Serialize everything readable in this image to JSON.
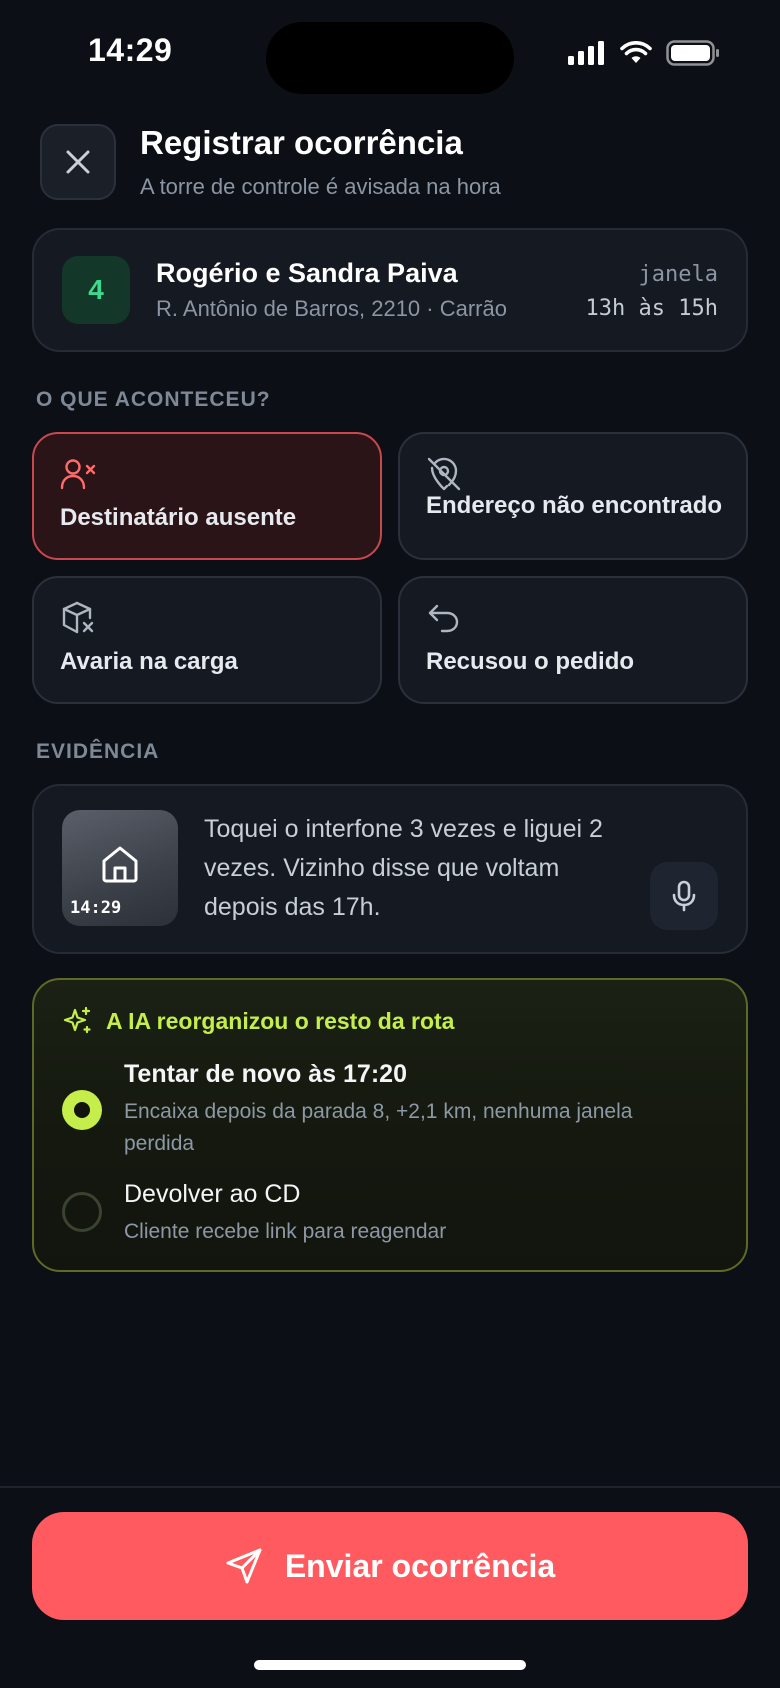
{
  "status_bar": {
    "time": "14:29"
  },
  "header": {
    "title": "Registrar ocorrência",
    "subtitle": "A torre de controle é avisada na hora"
  },
  "stop": {
    "number": "4",
    "name": "Rogério e Sandra Paiva",
    "address": "R. Antônio de Barros, 2210 · Carrão",
    "window_label": "janela",
    "window_time": "13h às 15h"
  },
  "reasons": {
    "section_label": "O QUE ACONTECEU?",
    "items": [
      {
        "label": "Destinatário ausente",
        "icon": "user-x-icon",
        "selected": true
      },
      {
        "label": "Endereço não encontrado",
        "icon": "map-pin-off-icon",
        "selected": false
      },
      {
        "label": "Avaria na carga",
        "icon": "package-x-icon",
        "selected": false
      },
      {
        "label": "Recusou o pedido",
        "icon": "undo-arrow-icon",
        "selected": false
      }
    ]
  },
  "evidence": {
    "section_label": "EVIDÊNCIA",
    "photo_time": "14:29",
    "note": "Toquei o interfone 3 vezes e liguei 2 vezes. Vizinho disse que voltam depois das 17h."
  },
  "ai": {
    "title": "A IA reorganizou o resto da rota",
    "options": [
      {
        "title": "Tentar de novo às 17:20",
        "desc": "Encaixa depois da parada 8, +2,1 km, nenhuma janela perdida",
        "selected": true
      },
      {
        "title": "Devolver ao CD",
        "desc": "Cliente recebe link para reagendar",
        "selected": false
      }
    ]
  },
  "actions": {
    "send_label": "Enviar ocorrência"
  },
  "colors": {
    "background": "#0c0f15",
    "accent_red": "#ff5a5f",
    "accent_lime": "#c5ee4a",
    "stop_green": "#3fd98d"
  }
}
